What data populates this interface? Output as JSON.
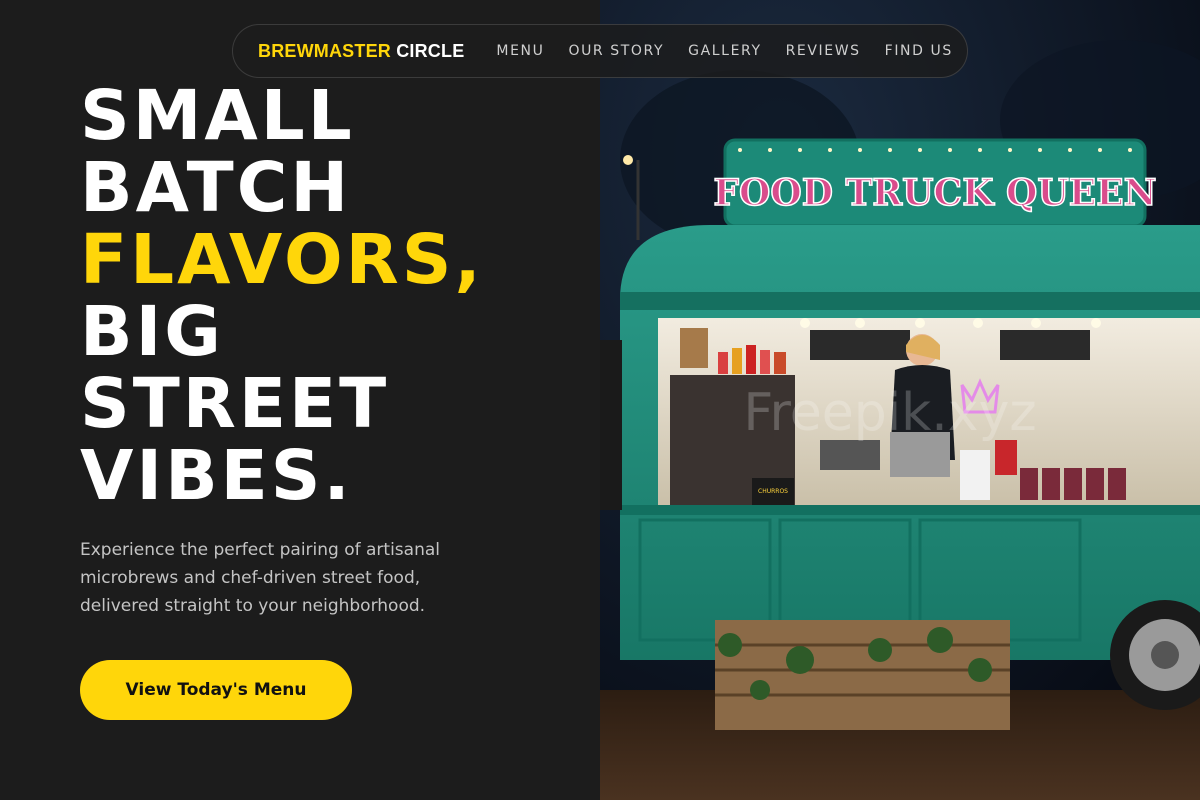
{
  "brand": {
    "part1": "BREWMASTER",
    "part2": "CIRCLE"
  },
  "nav": {
    "links": [
      {
        "label": "MENU"
      },
      {
        "label": "OUR STORY"
      },
      {
        "label": "GALLERY"
      },
      {
        "label": "REVIEWS"
      },
      {
        "label": "FIND US"
      }
    ]
  },
  "hero": {
    "headline_lines": [
      "SMALL",
      "BATCH",
      "FLAVORS,",
      "BIG",
      "STREET",
      "VIBES."
    ],
    "subtitle": "Experience the perfect pairing of artisanal microbrews and chef-driven street food, delivered straight to your neighborhood.",
    "cta_label": "View Today's Menu",
    "photo": {
      "truck_sign": "FOOD TRUCK QUEEN",
      "board_text": "CHURROS",
      "watermark": "Freepik.xyz"
    }
  },
  "colors": {
    "accent": "#ffd60a",
    "background": "#1c1c1c",
    "truck": "#1f8f7e"
  }
}
